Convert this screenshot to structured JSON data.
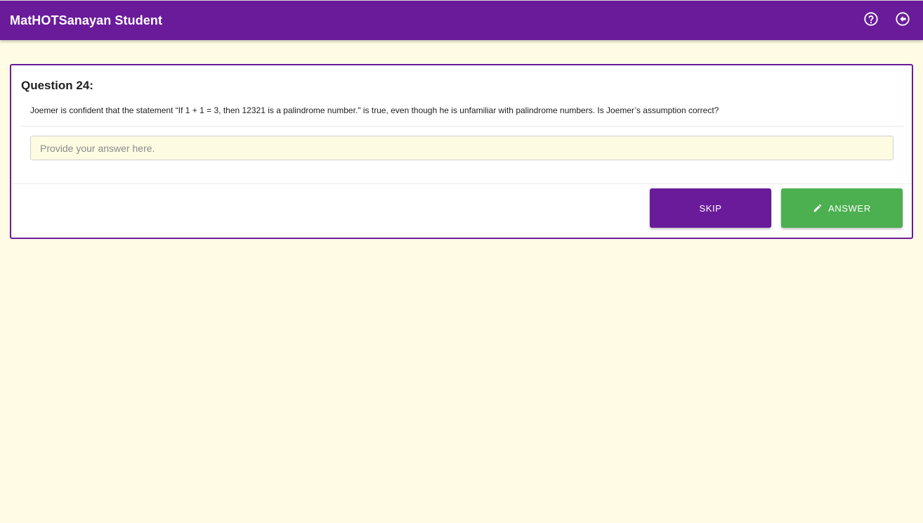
{
  "app_bar": {
    "title": "MatHOTSanayan Student",
    "actions": [
      {
        "icon": "help-circle-icon"
      },
      {
        "icon": "back-circle-icon"
      }
    ]
  },
  "question": {
    "title": "Question 24:",
    "text": "Joemer is confident that the statement “If 1 + 1 = 3, then 12321 is a palindrome number.\" is true, even though he is unfamiliar with palindrome numbers. Is Joemer’s assumption correct?"
  },
  "answer_input": {
    "value": "",
    "placeholder": "Provide your answer here."
  },
  "buttons": {
    "skip_label": "SKIP",
    "answer_label": "ANSWER",
    "answer_icon": "pencil-icon"
  },
  "colors": {
    "primary": "#6a1b9a",
    "success": "#4caf50",
    "background": "#fffbe5",
    "input_background": "#fdfce3"
  }
}
